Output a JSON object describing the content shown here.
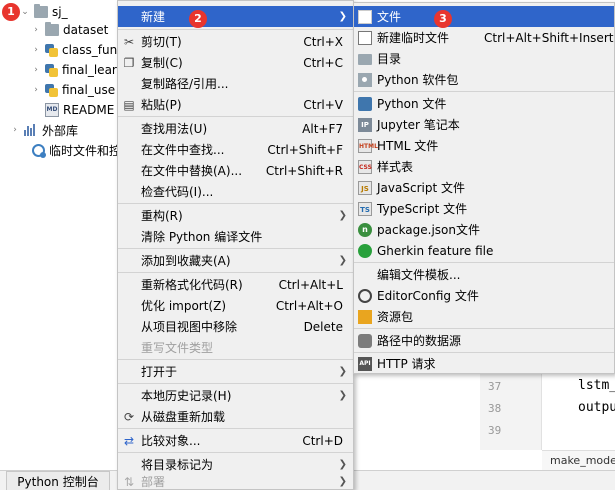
{
  "badges": [
    "1",
    "2",
    "3"
  ],
  "tree": {
    "root_label": "sj_",
    "items": [
      {
        "label": "dataset",
        "icon": "folder-icon",
        "expand": "›"
      },
      {
        "label": "class_fun",
        "icon": "python-file-icon",
        "expand": "›"
      },
      {
        "label": "final_lear",
        "icon": "python-file-icon",
        "expand": "›"
      },
      {
        "label": "final_use",
        "icon": "python-file-icon",
        "expand": "›"
      },
      {
        "label": "README",
        "icon": "markdown-file-icon",
        "expand": ""
      },
      {
        "label": "外部库",
        "icon": "library-icon",
        "expand": "›"
      },
      {
        "label": "临时文件和控",
        "icon": "scratches-icon",
        "expand": ""
      }
    ]
  },
  "context_menu": {
    "items": [
      {
        "label": "新建",
        "shortcut": "",
        "submenu": true,
        "icon": "",
        "selected": true
      },
      {
        "label": "剪切(T)",
        "shortcut": "Ctrl+X",
        "icon": "scissors-icon"
      },
      {
        "label": "复制(C)",
        "shortcut": "Ctrl+C",
        "icon": "copy-icon"
      },
      {
        "label": "复制路径/引用...",
        "shortcut": "",
        "icon": ""
      },
      {
        "label": "粘贴(P)",
        "shortcut": "Ctrl+V",
        "icon": "paste-icon"
      },
      {
        "label": "查找用法(U)",
        "shortcut": "Alt+F7",
        "icon": ""
      },
      {
        "label": "在文件中查找...",
        "shortcut": "Ctrl+Shift+F",
        "icon": ""
      },
      {
        "label": "在文件中替换(A)...",
        "shortcut": "Ctrl+Shift+R",
        "icon": ""
      },
      {
        "label": "检查代码(I)...",
        "shortcut": "",
        "icon": ""
      },
      {
        "label": "重构(R)",
        "shortcut": "",
        "submenu": true,
        "icon": ""
      },
      {
        "label": "清除 Python 编译文件",
        "shortcut": "",
        "icon": ""
      },
      {
        "label": "添加到收藏夹(A)",
        "shortcut": "",
        "submenu": true,
        "icon": ""
      },
      {
        "label": "重新格式化代码(R)",
        "shortcut": "Ctrl+Alt+L",
        "icon": ""
      },
      {
        "label": "优化 import(Z)",
        "shortcut": "Ctrl+Alt+O",
        "icon": ""
      },
      {
        "label": "从项目视图中移除",
        "shortcut": "Delete",
        "icon": ""
      },
      {
        "label": "重写文件类型",
        "shortcut": "",
        "icon": "",
        "disabled": true
      },
      {
        "label": "打开于",
        "shortcut": "",
        "submenu": true,
        "icon": ""
      },
      {
        "label": "本地历史记录(H)",
        "shortcut": "",
        "submenu": true,
        "icon": ""
      },
      {
        "label": "从磁盘重新加载",
        "shortcut": "",
        "icon": "reload-icon"
      },
      {
        "label": "比较对象...",
        "shortcut": "Ctrl+D",
        "icon": "compare-icon"
      },
      {
        "label": "将目录标记为",
        "shortcut": "",
        "submenu": true,
        "icon": ""
      },
      {
        "label": "部署",
        "shortcut": "",
        "submenu": true,
        "icon": "deploy-icon",
        "disabled": true
      }
    ]
  },
  "submenu": {
    "items": [
      {
        "label": "文件",
        "shortcut": "",
        "icon": "file-icon",
        "selected": true
      },
      {
        "label": "新建临时文件",
        "shortcut": "Ctrl+Alt+Shift+Insert",
        "icon": "scratch-file-icon"
      },
      {
        "label": "目录",
        "shortcut": "",
        "icon": "directory-icon"
      },
      {
        "label": "Python 软件包",
        "shortcut": "",
        "icon": "python-package-icon"
      },
      {
        "label": "Python 文件",
        "shortcut": "",
        "icon": "python-file-icon"
      },
      {
        "label": "Jupyter 笔记本",
        "shortcut": "",
        "icon": "jupyter-icon",
        "glyph": "IP"
      },
      {
        "label": "HTML 文件",
        "shortcut": "",
        "icon": "html-icon",
        "glyph": "HTML"
      },
      {
        "label": "样式表",
        "shortcut": "",
        "icon": "css-icon",
        "glyph": "CSS"
      },
      {
        "label": "JavaScript 文件",
        "shortcut": "",
        "icon": "javascript-icon",
        "glyph": "JS"
      },
      {
        "label": "TypeScript 文件",
        "shortcut": "",
        "icon": "typescript-icon",
        "glyph": "TS"
      },
      {
        "label": "package.json文件",
        "shortcut": "",
        "icon": "package-json-icon",
        "glyph": "n"
      },
      {
        "label": "Gherkin feature file",
        "shortcut": "",
        "icon": "gherkin-icon"
      },
      {
        "label": "编辑文件模板...",
        "shortcut": "",
        "icon": ""
      },
      {
        "label": "EditorConfig 文件",
        "shortcut": "",
        "icon": "editorconfig-icon"
      },
      {
        "label": "资源包",
        "shortcut": "",
        "icon": "resource-bundle-icon"
      },
      {
        "label": "路径中的数据源",
        "shortcut": "",
        "icon": "datasource-icon"
      },
      {
        "label": "HTTP 请求",
        "shortcut": "",
        "icon": "http-request-icon",
        "glyph": "API"
      }
    ]
  },
  "editor": {
    "line_numbers": [
      "37",
      "38",
      "39"
    ],
    "lines": [
      "lstm_",
      "outpu",
      ""
    ],
    "footer": "make_mode"
  },
  "bottom": {
    "console_tab": "Python 控制台"
  },
  "colors": {
    "selection": "#2f65ca",
    "menu_bg": "#f0f0f0",
    "badge": "#e8352e"
  }
}
